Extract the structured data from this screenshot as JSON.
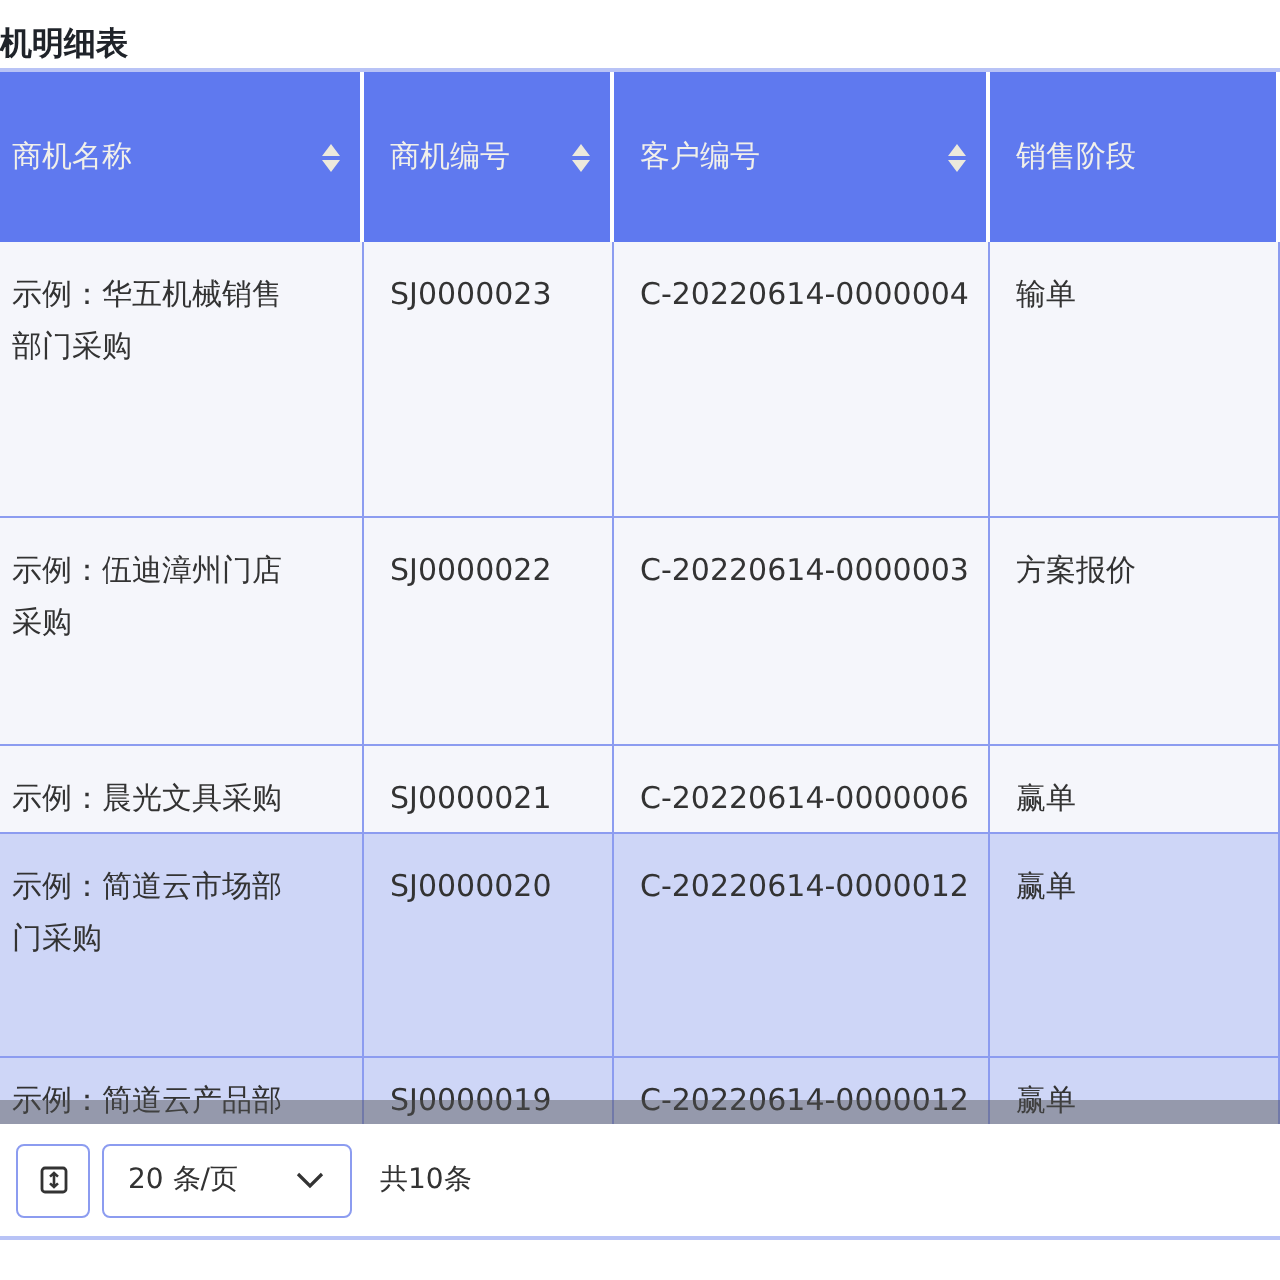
{
  "title": "机明细表",
  "table": {
    "columns": [
      {
        "label": "商机名称",
        "sortable": true
      },
      {
        "label": "商机编号",
        "sortable": true
      },
      {
        "label": "客户编号",
        "sortable": true
      },
      {
        "label": "销售阶段",
        "sortable": false
      }
    ],
    "rows": [
      {
        "selected": false,
        "cells": [
          "示例：华五机械销售部门采购",
          "SJ0000023",
          "C-20220614-0000004",
          "输单"
        ]
      },
      {
        "selected": false,
        "cells": [
          "示例：伍迪漳州门店采购",
          "SJ0000022",
          "C-20220614-0000003",
          "方案报价"
        ]
      },
      {
        "selected": false,
        "cells": [
          "示例：晨光文具采购",
          "SJ0000021",
          "C-20220614-0000006",
          "赢单"
        ]
      },
      {
        "selected": true,
        "cells": [
          "示例：简道云市场部门采购",
          "SJ0000020",
          "C-20220614-0000012",
          "赢单"
        ]
      },
      {
        "selected": true,
        "cells": [
          "示例：简道云产品部",
          "SJ0000019",
          "C-20220614-0000012",
          "赢单"
        ]
      }
    ]
  },
  "pagination": {
    "page_size": "20 条/页",
    "total": "共10条"
  }
}
